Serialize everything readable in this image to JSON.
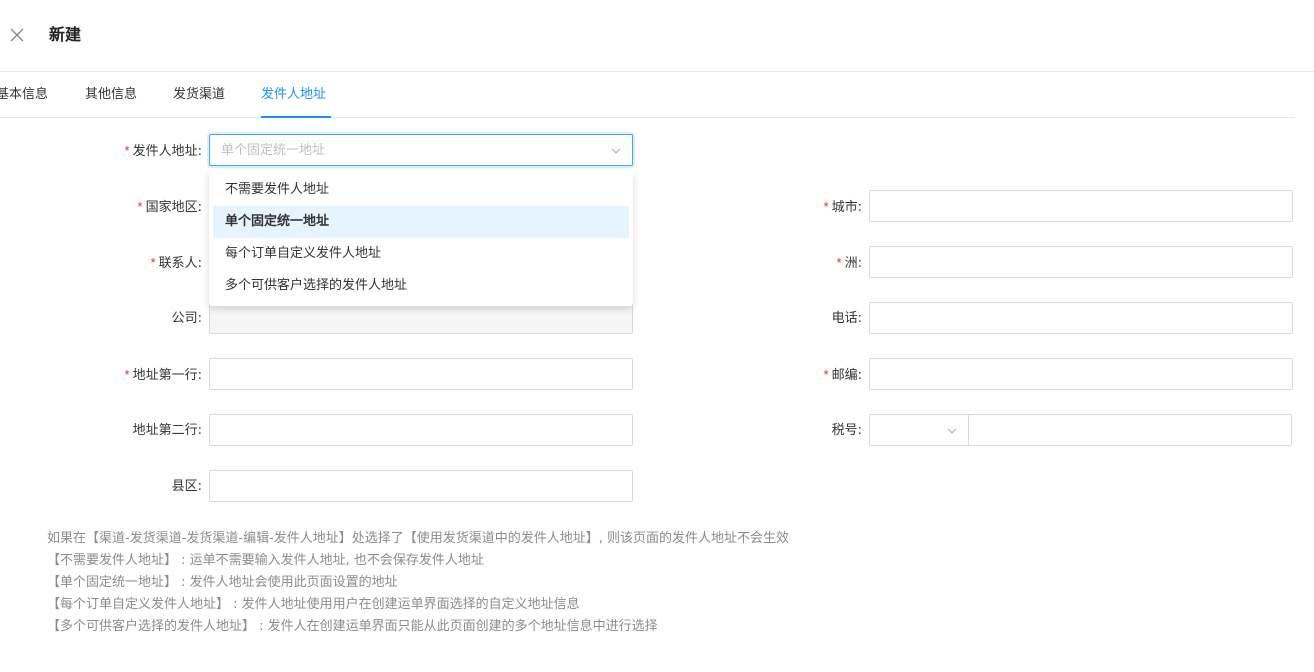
{
  "header": {
    "title": "新建"
  },
  "tabs": [
    {
      "label": "基本信息",
      "active": false
    },
    {
      "label": "其他信息",
      "active": false
    },
    {
      "label": "发货渠道",
      "active": false
    },
    {
      "label": "发件人地址",
      "active": true
    }
  ],
  "form": {
    "sender_address": {
      "label": "发件人地址:",
      "required": true,
      "placeholder": "单个固定统一地址"
    },
    "country": {
      "label": "国家地区:",
      "required": true,
      "value": ""
    },
    "contact": {
      "label": "联系人:",
      "required": true,
      "value": ""
    },
    "company": {
      "label": "公司:",
      "required": false,
      "value": ""
    },
    "address_line1": {
      "label": "地址第一行:",
      "required": true,
      "value": ""
    },
    "address_line2": {
      "label": "地址第二行:",
      "required": false,
      "value": ""
    },
    "county": {
      "label": "县区:",
      "required": false,
      "value": ""
    },
    "city": {
      "label": "城市:",
      "required": true,
      "value": ""
    },
    "state": {
      "label": "洲:",
      "required": true,
      "value": ""
    },
    "phone": {
      "label": "电话:",
      "required": false,
      "value": ""
    },
    "postcode": {
      "label": "邮编:",
      "required": true,
      "value": ""
    },
    "tax_id": {
      "label": "税号:",
      "required": false,
      "type_value": "",
      "value": ""
    }
  },
  "dropdown": {
    "options": [
      {
        "label": "不需要发件人地址",
        "selected": false
      },
      {
        "label": "单个固定统一地址",
        "selected": true
      },
      {
        "label": "每个订单自定义发件人地址",
        "selected": false
      },
      {
        "label": "多个可供客户选择的发件人地址",
        "selected": false
      }
    ]
  },
  "notes": [
    "如果在【渠道-发货渠道-发货渠道-编辑-发件人地址】处选择了【使用发货渠道中的发件人地址】, 则该页面的发件人地址不会生效",
    "【不需要发件人地址】 : 运单不需要输入发件人地址, 也不会保存发件人地址",
    "【单个固定统一地址】 : 发件人地址会使用此页面设置的地址",
    "【每个订单自定义发件人地址】 : 发件人地址使用用户在创建运单界面选择的自定义地址信息",
    "【多个可供客户选择的发件人地址】 : 发件人在创建运单界面只能从此页面创建的多个地址信息中进行选择"
  ],
  "colors": {
    "accent": "#1890ff",
    "required": "#f5222d",
    "selected_bg": "#e6f4ff",
    "note_text": "#8c8c8c"
  },
  "icons": {
    "close": "close-icon",
    "select_arrow": "chevron-down-icon"
  }
}
